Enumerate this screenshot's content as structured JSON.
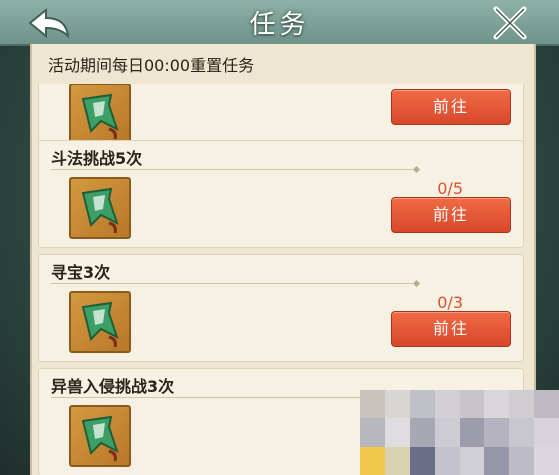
{
  "header": {
    "title": "任务",
    "back_icon": "back-arrow-icon",
    "close_icon": "crossed-swords-close-icon"
  },
  "notice": "活动期间每日00:00重置任务",
  "tasks": [
    {
      "title": "",
      "progress": "",
      "button": "前往",
      "reward_icon": "green-banner-icon"
    },
    {
      "title": "斗法挑战5次",
      "progress": "0/5",
      "button": "前往",
      "reward_icon": "green-banner-icon"
    },
    {
      "title": "寻宝3次",
      "progress": "0/3",
      "button": "前往",
      "reward_icon": "green-banner-icon"
    },
    {
      "title": "异兽入侵挑战3次",
      "progress": "",
      "button": "",
      "reward_icon": "green-banner-icon"
    }
  ],
  "colors": {
    "button": "#e65a38",
    "progress": "#d8532c",
    "panel": "#efe6d2"
  }
}
